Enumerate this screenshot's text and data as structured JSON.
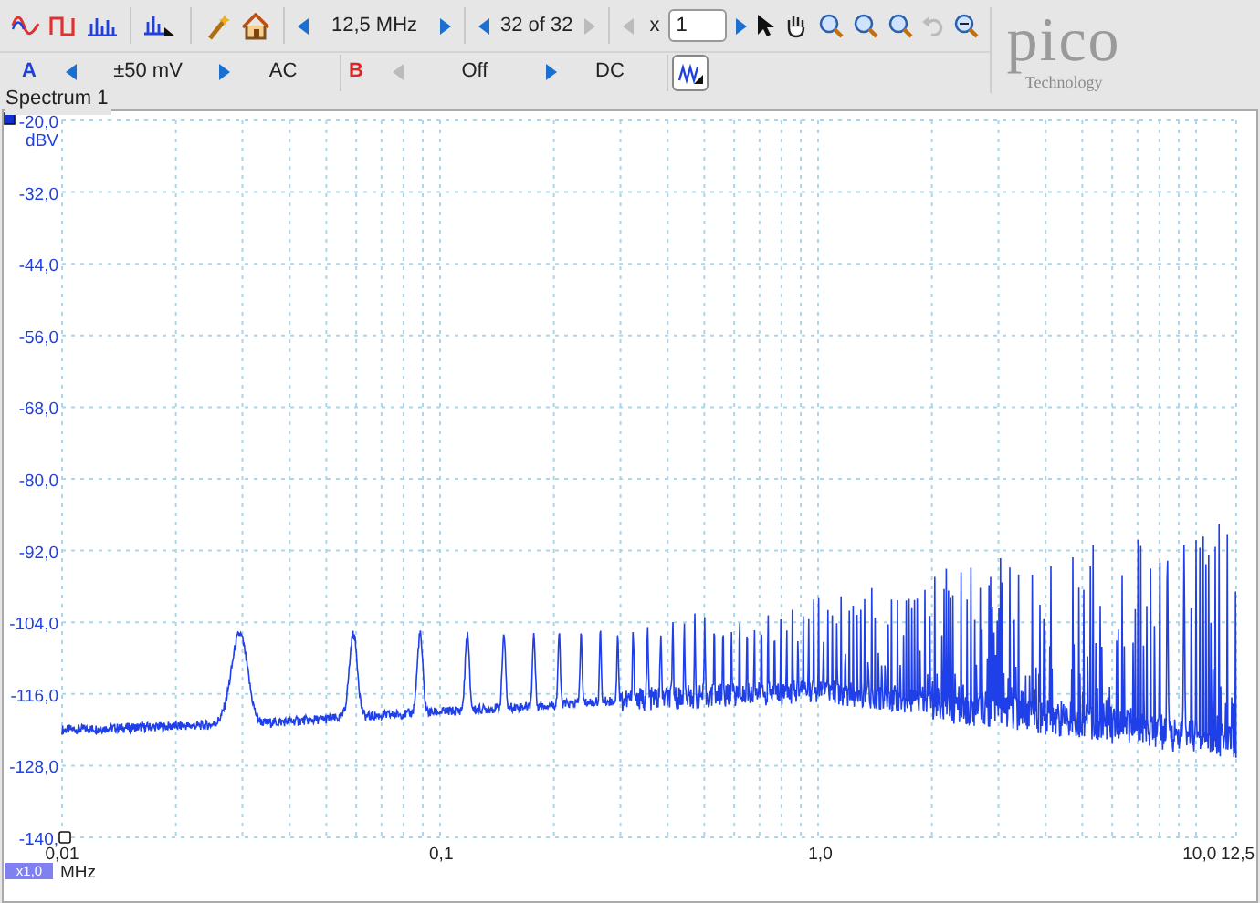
{
  "toolbar": {
    "timebase": "12,5 MHz",
    "buffer": {
      "text": "32 of 32",
      "next_disabled": true
    },
    "zoom": {
      "label": "x",
      "value": "1",
      "prev_disabled": true
    }
  },
  "channels": [
    {
      "label": "A",
      "color": "#1f3fdc",
      "range": "±50 mV",
      "coupling": "AC",
      "prev_disabled": false
    },
    {
      "label": "B",
      "color": "#e02424",
      "range": "Off",
      "coupling": "DC",
      "prev_disabled": true
    }
  ],
  "logo": {
    "name": "pico",
    "tagline": "Technology"
  },
  "view": {
    "tab": "Spectrum 1",
    "x_scale": "x1,0",
    "x_unit": "MHz",
    "y_unit": "dBV",
    "x_axis_labels": [
      "0,01",
      "0,1",
      "1,0",
      "10,0",
      "12,5"
    ],
    "y_axis_labels": [
      "-20,0",
      "-32,0",
      "-44,0",
      "-56,0",
      "-68,0",
      "-80,0",
      "-92,0",
      "-104,0",
      "-116,0",
      "-128,0",
      "-140,"
    ]
  }
}
